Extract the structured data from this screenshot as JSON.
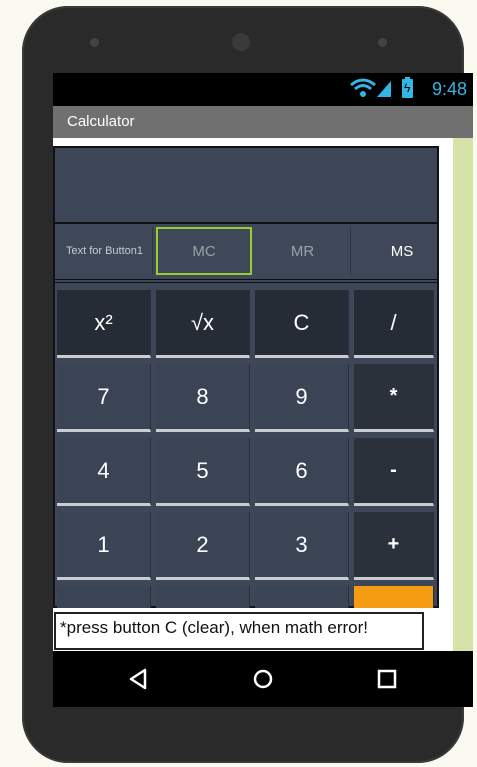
{
  "status": {
    "time": "9:48",
    "battery_color": "#33b5e5"
  },
  "app": {
    "title": "Calculator"
  },
  "display": {
    "value": ""
  },
  "memory_row": [
    {
      "label": "Text for Button1",
      "name": "text-for-button1"
    },
    {
      "label": "MC",
      "name": "mc-button"
    },
    {
      "label": "MR",
      "name": "mr-button"
    },
    {
      "label": "MS",
      "name": "ms-button"
    }
  ],
  "keys": [
    [
      "x²",
      "√x",
      "C",
      "/"
    ],
    [
      "7",
      "8",
      "9",
      "*"
    ],
    [
      "4",
      "5",
      "6",
      "-"
    ],
    [
      "1",
      "2",
      "3",
      "+"
    ]
  ],
  "hint": "*press button C (clear), when math error!",
  "colors": {
    "accent": "#f39c12",
    "focus": "#9acd32",
    "side_bar": "#d5e2a8"
  },
  "nav": {
    "back": "back-icon",
    "home": "home-icon",
    "recents": "recents-icon"
  }
}
